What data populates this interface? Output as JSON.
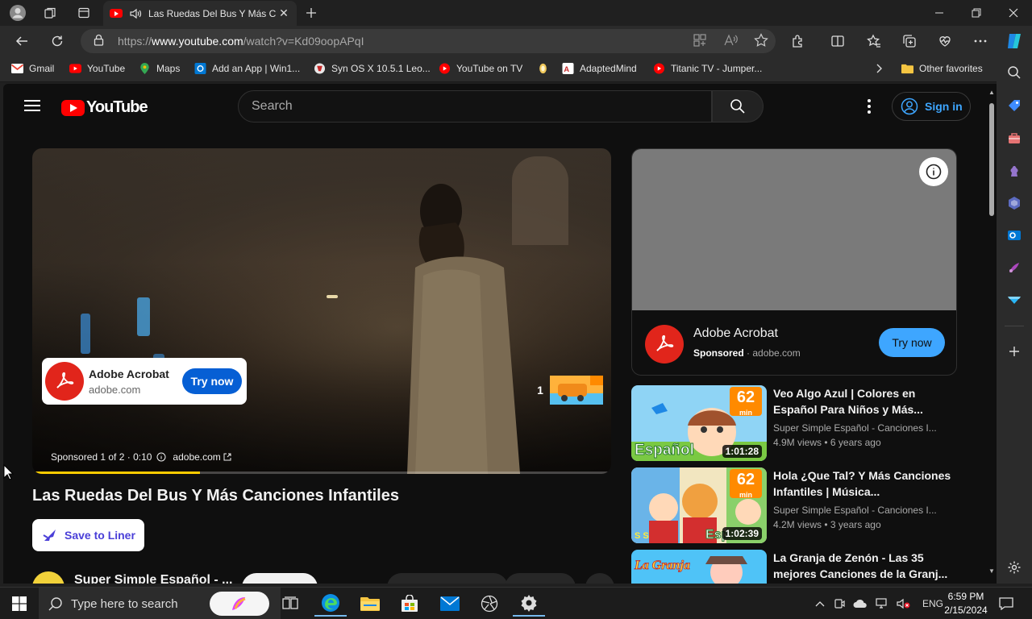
{
  "browser": {
    "tab_title": "Las Ruedas Del Bus Y Más C",
    "url_prefix": "https://",
    "url_host": "www.youtube.com",
    "url_path": "/watch?v=Kd09oopAPqI"
  },
  "favorites": [
    {
      "label": "Gmail",
      "icon": "gmail-icon"
    },
    {
      "label": "YouTube",
      "icon": "youtube-icon"
    },
    {
      "label": "Maps",
      "icon": "maps-icon"
    },
    {
      "label": "Add an App | Win1...",
      "icon": "app-icon"
    },
    {
      "label": "Syn OS X 10.5.1 Leo...",
      "icon": "syn-icon"
    },
    {
      "label": "YouTube on TV",
      "icon": "youtube-icon"
    },
    {
      "label": "",
      "icon": "peanut-icon"
    },
    {
      "label": "AdaptedMind",
      "icon": "adaptedmind-icon"
    },
    {
      "label": "Titanic TV - Jumper...",
      "icon": "youtube-icon"
    },
    {
      "label": "Other favorites",
      "icon": "folder-icon"
    }
  ],
  "youtube": {
    "logo_text": "YouTube",
    "search_placeholder": "Search",
    "signin_label": "Sign in"
  },
  "player": {
    "ad_name": "Adobe Acrobat",
    "ad_domain": "adobe.com",
    "ad_cta": "Try now",
    "skip_count": "1",
    "sponsored_text": "Sponsored 1 of 2 · 0:10",
    "sponsored_domain": "adobe.com",
    "progress_fraction": 0.29
  },
  "video": {
    "title": "Las Ruedas Del Bus Y Más Canciones Infantiles",
    "liner_label": "Save to Liner",
    "channel_name": "Super Simple Español - ..."
  },
  "side_ad": {
    "name": "Adobe Acrobat",
    "sponsored": "Sponsored",
    "domain": "adobe.com",
    "cta": "Try now"
  },
  "recommendations": [
    {
      "title": "Veo Algo Azul | Colores en Español Para Niños y Más...",
      "channel": "Super Simple Español - Canciones I...",
      "views": "4.9M views",
      "age": "6 years ago",
      "duration": "1:01:28",
      "minutes": "62",
      "min_label": "min",
      "badge": "Español"
    },
    {
      "title": "Hola ¿Que Tal? Y Más Canciones Infantiles | Música...",
      "channel": "Super Simple Español - Canciones I...",
      "views": "4.2M views",
      "age": "3 years ago",
      "duration": "1:02:39",
      "minutes": "62",
      "min_label": "min",
      "badge": "Esp"
    },
    {
      "title": "La Granja de Zenón - Las 35 mejores Canciones de la Granj...",
      "channel": "",
      "views": "",
      "age": "",
      "duration": "",
      "minutes": "",
      "min_label": "",
      "badge": "La Granja"
    }
  ],
  "taskbar": {
    "search_placeholder": "Type here to search",
    "language": "ENG",
    "time": "6:59 PM",
    "date": "2/15/2024"
  },
  "colors": {
    "yt_red": "#ff0000",
    "link_blue": "#3ea6ff",
    "cta_blue": "#065fd4",
    "adobe_red": "#e1251b"
  }
}
